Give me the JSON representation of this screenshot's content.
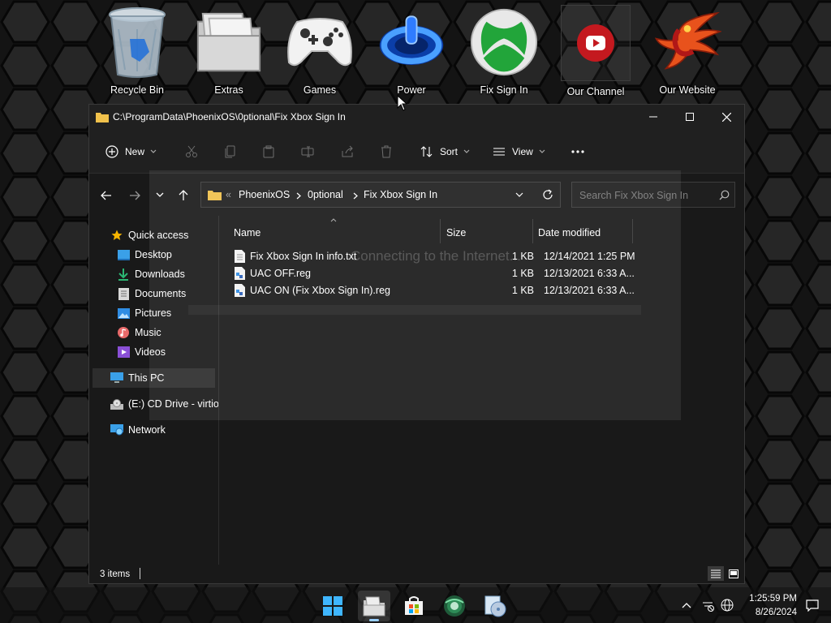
{
  "desktop": {
    "icons": [
      {
        "label": "Recycle Bin",
        "icon": "recycle-bin-icon"
      },
      {
        "label": "Extras",
        "icon": "folder-icon"
      },
      {
        "label": "Games",
        "icon": "gamepad-icon"
      },
      {
        "label": "Power",
        "icon": "power-icon"
      },
      {
        "label": "Fix Sign In",
        "icon": "xbox-icon"
      },
      {
        "label": "Our Channel",
        "icon": "youtube-icon"
      },
      {
        "label": "Our Website",
        "icon": "phoenix-icon"
      }
    ]
  },
  "window": {
    "title": "C:\\ProgramData\\PhoenixOS\\0ptional\\Fix Xbox Sign In",
    "toolbar": {
      "new_label": "New",
      "sort_label": "Sort",
      "view_label": "View"
    },
    "address": {
      "separator": "«",
      "segments": [
        "PhoenixOS",
        "0ptional",
        "Fix Xbox Sign In"
      ]
    },
    "search": {
      "placeholder": "Search Fix Xbox Sign In"
    },
    "nav": {
      "quick_access": "Quick access",
      "items": [
        "Desktop",
        "Downloads",
        "Documents",
        "Pictures",
        "Music",
        "Videos"
      ],
      "this_pc": "This PC",
      "cd_drive": "(E:) CD Drive - virtio",
      "network": "Network"
    },
    "columns": {
      "name": "Name",
      "size": "Size",
      "date": "Date modified"
    },
    "files": [
      {
        "name": "Fix Xbox Sign In info.txt",
        "size": "1 KB",
        "date": "12/14/2021 1:25 PM",
        "icon": "text-file-icon"
      },
      {
        "name": "UAC OFF.reg",
        "size": "1 KB",
        "date": "12/13/2021 6:33 A...",
        "icon": "registry-file-icon"
      },
      {
        "name": "UAC ON (Fix Xbox Sign In).reg",
        "size": "1 KB",
        "date": "12/13/2021 6:33 A...",
        "icon": "registry-file-icon"
      }
    ],
    "status": {
      "count": "3 items"
    }
  },
  "overlay": {
    "ghost_text": "Connecting to the Internet..."
  },
  "taskbar": {
    "apps": [
      "start-icon",
      "file-explorer-icon",
      "store-icon",
      "browser-icon",
      "disc-tool-icon"
    ],
    "clock": {
      "time": "1:25:59 PM",
      "date": "8/26/2024"
    }
  },
  "colors": {
    "window_bg": "#191919",
    "titlebar_bg": "#202020",
    "accent": "#0078d4",
    "folder": "#f0c14b"
  }
}
